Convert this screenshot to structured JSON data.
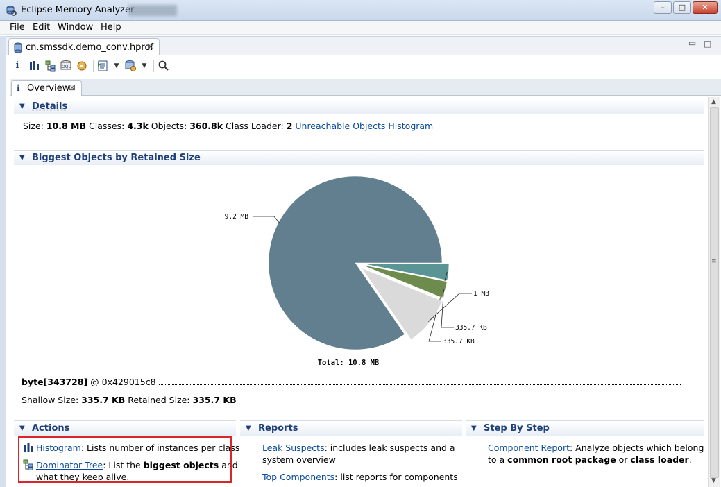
{
  "window": {
    "title": "Eclipse Memory Analyzer",
    "minimize": "–",
    "maximize": "□",
    "close": "✕"
  },
  "menu": [
    {
      "key": "F",
      "rest": "ile"
    },
    {
      "key": "E",
      "rest": "dit"
    },
    {
      "key": "W",
      "rest": "indow"
    },
    {
      "key": "H",
      "rest": "elp"
    }
  ],
  "editor_tab": {
    "label": "cn.smssdk.demo_conv.hprof",
    "close": "⊠"
  },
  "view_tab": {
    "label": "Overview",
    "close": "⊠"
  },
  "details": {
    "heading": "Details",
    "size_label": "Size:",
    "size": "10.8 MB",
    "classes_label": "Classes:",
    "classes": "4.3k",
    "objects_label": "Objects:",
    "objects": "360.8k",
    "loader_label": "Class Loader:",
    "loader": "2",
    "histogram_link": "Unreachable Objects Histogram"
  },
  "biggest": {
    "heading": "Biggest Objects by Retained Size",
    "total": "Total: 10.8 MB",
    "object_name": "byte[343728]",
    "object_addr": "@ 0x429015c8",
    "shallow_label": "Shallow Size:",
    "shallow": "335.7 KB",
    "retained_label": "Retained Size:",
    "retained": "335.7 KB"
  },
  "chart_data": {
    "type": "pie",
    "title": "",
    "slices": [
      {
        "label": "9.2 MB",
        "value": 9.2,
        "color": "#617f8e"
      },
      {
        "label": "335.7 KB",
        "value": 0.3357,
        "color": "#5b9494"
      },
      {
        "label": "335.7 KB",
        "value": 0.3357,
        "color": "#6e8b4e"
      },
      {
        "label": "1 MB",
        "value": 1.0,
        "color": "#dadada"
      }
    ],
    "total_label": "Total: 10.8 MB"
  },
  "actions": {
    "heading": "Actions",
    "histogram_link": "Histogram",
    "histogram_desc": ": Lists number of instances per class",
    "dominator_link": "Dominator Tree",
    "dominator_pre": ": List the ",
    "dominator_bold": "biggest objects",
    "dominator_post": " and",
    "dominator_line2": "what they keep alive."
  },
  "reports": {
    "heading": "Reports",
    "leak_link": "Leak Suspects",
    "leak_desc": ": includes leak suspects and a",
    "leak_line2": "system overview",
    "top_link": "Top Components",
    "top_desc": ": list reports for components"
  },
  "step": {
    "heading": "Step By Step",
    "component_link": "Component Report",
    "component_desc": ": Analyze objects which belong",
    "line2_pre": "to a ",
    "line2_bold1": "common root package",
    "line2_mid": " or ",
    "line2_bold2": "class loader",
    "line2_post": "."
  }
}
